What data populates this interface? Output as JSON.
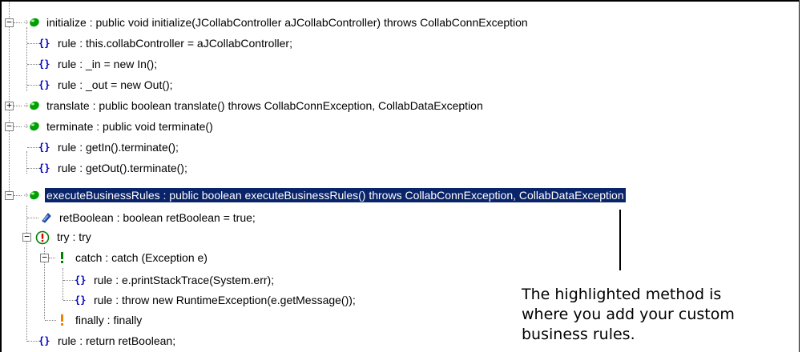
{
  "tree": {
    "nodes": [
      {
        "label": "initialize : public void initialize(JCollabController aJCollabController) throws CollabConnException",
        "icon": "method-icon",
        "expander": "minus"
      },
      {
        "label": "rule : this.collabController = aJCollabController;",
        "icon": "rule-icon"
      },
      {
        "label": "rule : _in = new In();",
        "icon": "rule-icon"
      },
      {
        "label": "rule : _out = new Out();",
        "icon": "rule-icon"
      },
      {
        "label": "translate : public boolean translate() throws CollabConnException, CollabDataException",
        "icon": "method-icon",
        "expander": "plus"
      },
      {
        "label": "terminate : public void terminate()",
        "icon": "method-icon",
        "expander": "minus"
      },
      {
        "label": "rule : getIn().terminate();",
        "icon": "rule-icon"
      },
      {
        "label": "rule : getOut().terminate();",
        "icon": "rule-icon"
      },
      {
        "label": "executeBusinessRules : public boolean executeBusinessRules() throws CollabConnException, CollabDataException",
        "icon": "method-icon",
        "expander": "minus",
        "selected": true
      },
      {
        "label": "retBoolean : boolean retBoolean = true;",
        "icon": "variable-icon"
      },
      {
        "label": "try : try",
        "icon": "try-icon",
        "expander": "minus"
      },
      {
        "label": "catch : catch (Exception e)",
        "icon": "catch-icon",
        "expander": "minus"
      },
      {
        "label": "rule : e.printStackTrace(System.err);",
        "icon": "rule-icon"
      },
      {
        "label": "rule : throw new RuntimeException(e.getMessage());",
        "icon": "rule-icon"
      },
      {
        "label": "finally : finally",
        "icon": "finally-icon"
      },
      {
        "label": "rule : return retBoolean;",
        "icon": "rule-icon"
      }
    ]
  },
  "callout": {
    "line1": "The highlighted method is",
    "line2": "where you add your custom",
    "line3": "business rules."
  },
  "colors": {
    "selection": "#0a246a",
    "method_green": "#00a000",
    "rule_blue": "#0000c0",
    "exception_red": "#e00000",
    "catch_green": "#008000",
    "finally_orange": "#f08000"
  }
}
